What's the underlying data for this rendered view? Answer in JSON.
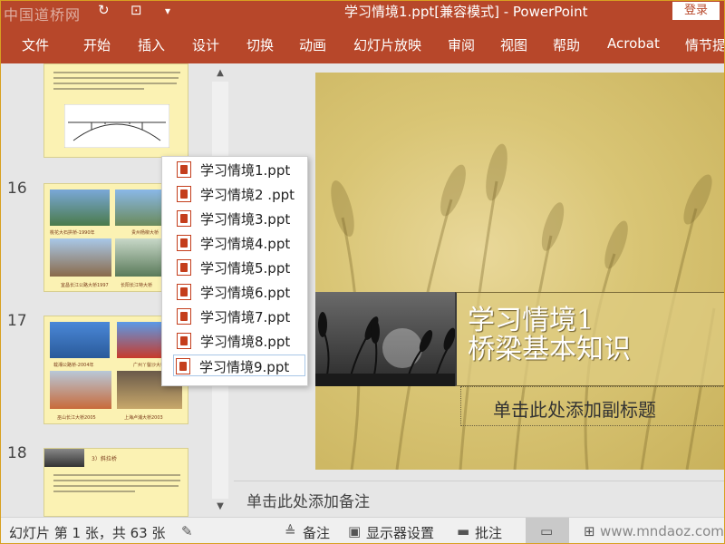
{
  "titlebar": {
    "watermark": "中国道桥网",
    "title": "学习情境1.ppt[兼容模式] - PowerPoint",
    "login": "登录",
    "icons": [
      "refresh-icon",
      "presenter-icon",
      "customize-icon"
    ]
  },
  "ribbon": {
    "tabs": [
      "文件",
      "开始",
      "插入",
      "设计",
      "切换",
      "动画",
      "幻灯片放映",
      "审阅",
      "视图",
      "帮助",
      "Acrobat",
      "情节提"
    ]
  },
  "thumbnails": {
    "slide_numbers": [
      "16",
      "17",
      "18"
    ],
    "slide16_captions": [
      "桃花大石拱桥-1990年",
      "贵州杨柳大桥",
      "宜昌长江公路大桥1997",
      "长阳长江特大桥"
    ],
    "slide17_captions": [
      "载湘公路桥-2004年",
      "广州丫髻沙大桥",
      "巫山长江大桥2005",
      "上海卢浦大桥2003"
    ],
    "slide18_heading": "3）斜拉桥"
  },
  "popup": {
    "files": [
      "学习情境1.ppt",
      "学习情境2 .ppt",
      "学习情境3.ppt",
      "学习情境4.ppt",
      "学习情境5.ppt",
      "学习情境6.ppt",
      "学习情境7.ppt",
      "学习情境8.ppt",
      "学习情境9.ppt"
    ],
    "highlighted_index": 8
  },
  "slide": {
    "title_line1": "学习情境1",
    "title_line2": "桥梁基本知识",
    "subtitle_placeholder": "单击此处添加副标题"
  },
  "notes": {
    "placeholder": "单击此处添加备注"
  },
  "status": {
    "slide_info": "幻灯片 第 1 张，共 63 张",
    "notes": "备注",
    "display_settings": "显示器设置",
    "comments": "批注",
    "watermark_url": "www.mndaoz.com"
  },
  "colors": {
    "accent": "#b7472a",
    "thumb_bg": "#fbf2b3"
  }
}
